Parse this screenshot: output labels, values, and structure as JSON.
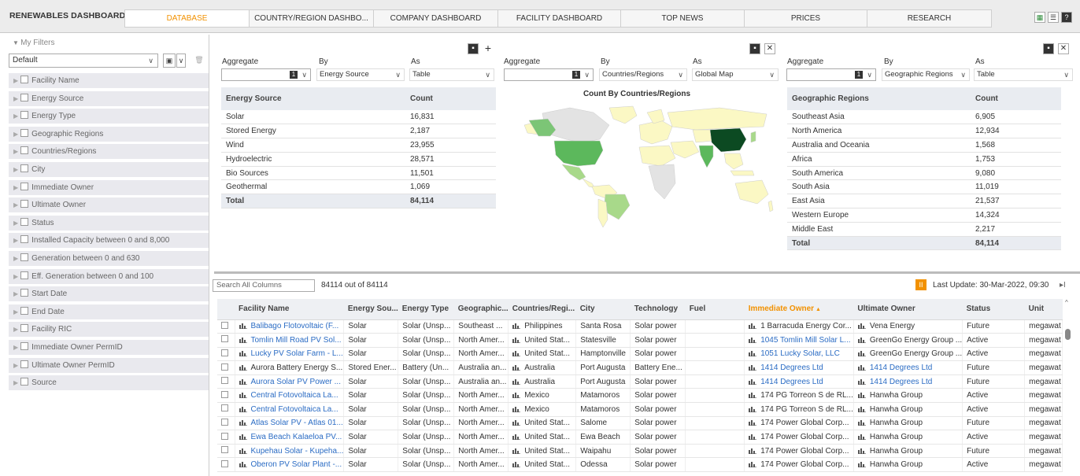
{
  "app": {
    "title": "RENEWABLES DASHBOARD",
    "tabs": [
      {
        "label": "DATABASE",
        "active": true
      },
      {
        "label": "COUNTRY/REGION DASHBO...",
        "active": false
      },
      {
        "label": "COMPANY DASHBOARD",
        "active": false
      },
      {
        "label": "FACILITY DASHBOARD",
        "active": false
      },
      {
        "label": "TOP NEWS",
        "active": false
      },
      {
        "label": "PRICES",
        "active": false
      },
      {
        "label": "RESEARCH",
        "active": false
      }
    ],
    "top_icons": [
      "excel-icon",
      "list-icon",
      "help-icon"
    ],
    "accent_color": "#f29100",
    "link_color": "#2b6cc4"
  },
  "sidebar": {
    "header": "My Filters",
    "selected_filter": "Default",
    "filters": [
      "Facility Name",
      "Energy Source",
      "Energy Type",
      "Geographic Regions",
      "Countries/Regions",
      "City",
      "Immediate Owner",
      "Ultimate Owner",
      "Status",
      "Installed Capacity between 0 and 8,000",
      "Generation between 0 and 630",
      "Eff. Generation between 0 and 100",
      "Start Date",
      "End Date",
      "Facility RIC",
      "Immediate Owner PermID",
      "Ultimate Owner PermID",
      "Source"
    ]
  },
  "widget1": {
    "aggregate_label": "Aggregate",
    "by_label": "By",
    "as_label": "As",
    "aggregate_num": "1",
    "by_value": "Energy Source",
    "as_value": "Table",
    "columns": [
      "Energy Source",
      "Count"
    ],
    "rows": [
      [
        "Solar",
        "16,831"
      ],
      [
        "Stored Energy",
        "2,187"
      ],
      [
        "Wind",
        "23,955"
      ],
      [
        "Hydroelectric",
        "28,571"
      ],
      [
        "Bio Sources",
        "11,501"
      ],
      [
        "Geothermal",
        "1,069"
      ]
    ],
    "total": [
      "Total",
      "84,114"
    ]
  },
  "widget2": {
    "aggregate_label": "Aggregate",
    "by_label": "By",
    "as_label": "As",
    "aggregate_num": "1",
    "by_value": "Countries/Regions",
    "as_value": "Global Map",
    "map_title": "Count By Countries/Regions",
    "map_colors": {
      "base": "#fbf8c4",
      "light_green": "#a8d98a",
      "mid_green": "#5cb85c",
      "dark_green": "#0c4a22",
      "none": "#e3e3e3"
    }
  },
  "widget3": {
    "aggregate_label": "Aggregate",
    "by_label": "By",
    "as_label": "As",
    "aggregate_num": "1",
    "by_value": "Geographic Regions",
    "as_value": "Table",
    "columns": [
      "Geographic Regions",
      "Count"
    ],
    "rows": [
      [
        "Southeast Asia",
        "6,905"
      ],
      [
        "North America",
        "12,934"
      ],
      [
        "Australia and Oceania",
        "1,568"
      ],
      [
        "Africa",
        "1,753"
      ],
      [
        "South America",
        "9,080"
      ],
      [
        "South Asia",
        "11,019"
      ],
      [
        "East Asia",
        "21,537"
      ],
      [
        "Western Europe",
        "14,324"
      ],
      [
        "Middle East",
        "2,217"
      ]
    ],
    "total": [
      "Total",
      "84,114"
    ]
  },
  "grid": {
    "search_placeholder": "Search All Columns",
    "count_text": "84114 out of 84114",
    "last_update": "Last Update: 30-Mar-2022, 09:30",
    "columns": [
      "Facility Name",
      "Energy Sou...",
      "Energy Type",
      "Geographic...",
      "Countries/Regi...",
      "City",
      "Technology",
      "Fuel",
      "Immediate Owner",
      "Ultimate Owner",
      "Status",
      "Unit"
    ],
    "sorted_column": "Immediate Owner",
    "rows": [
      [
        "Balibago Flotovoltaic (F...",
        "Solar",
        "Solar (Unsp...",
        "Southeast ...",
        "Philippines",
        "Santa Rosa",
        "Solar power",
        "",
        "1 Barracuda Energy Cor...",
        "Vena Energy",
        "Future",
        "megawat"
      ],
      [
        "Tomlin Mill Road PV Sol...",
        "Solar",
        "Solar (Unsp...",
        "North Amer...",
        "United Stat...",
        "Statesville",
        "Solar power",
        "",
        "1045 Tomlin Mill Solar L...",
        "GreenGo Energy Group ...",
        "Active",
        "megawat"
      ],
      [
        "Lucky PV Solar Farm - L...",
        "Solar",
        "Solar (Unsp...",
        "North Amer...",
        "United Stat...",
        "Hamptonville",
        "Solar power",
        "",
        "1051 Lucky Solar, LLC",
        "GreenGo Energy Group ...",
        "Active",
        "megawat"
      ],
      [
        "Aurora Battery Energy S...",
        "Stored Ener...",
        "Battery (Un...",
        "Australia an...",
        "Australia",
        "Port Augusta",
        "Battery Ene...",
        "",
        "1414 Degrees Ltd",
        "1414 Degrees Ltd",
        "Future",
        "megawat"
      ],
      [
        "Aurora Solar PV Power ...",
        "Solar",
        "Solar (Unsp...",
        "Australia an...",
        "Australia",
        "Port Augusta",
        "Solar power",
        "",
        "1414 Degrees Ltd",
        "1414 Degrees Ltd",
        "Future",
        "megawat"
      ],
      [
        "Central Fotovoltaica La...",
        "Solar",
        "Solar (Unsp...",
        "North Amer...",
        "Mexico",
        "Matamoros",
        "Solar power",
        "",
        "174 PG Torreon S de RL...",
        "Hanwha Group",
        "Active",
        "megawat"
      ],
      [
        "Central Fotovoltaica La...",
        "Solar",
        "Solar (Unsp...",
        "North Amer...",
        "Mexico",
        "Matamoros",
        "Solar power",
        "",
        "174 PG Torreon S de RL...",
        "Hanwha Group",
        "Active",
        "megawat"
      ],
      [
        "Atlas Solar PV - Atlas 01...",
        "Solar",
        "Solar (Unsp...",
        "North Amer...",
        "United Stat...",
        "Salome",
        "Solar power",
        "",
        "174 Power Global Corp...",
        "Hanwha Group",
        "Future",
        "megawat"
      ],
      [
        "Ewa Beach Kalaeloa PV...",
        "Solar",
        "Solar (Unsp...",
        "North Amer...",
        "United Stat...",
        "Ewa Beach",
        "Solar power",
        "",
        "174 Power Global Corp...",
        "Hanwha Group",
        "Active",
        "megawat"
      ],
      [
        "Kupehau Solar - Kupeha...",
        "Solar",
        "Solar (Unsp...",
        "North Amer...",
        "United Stat...",
        "Waipahu",
        "Solar power",
        "",
        "174 Power Global Corp...",
        "Hanwha Group",
        "Future",
        "megawat"
      ],
      [
        "Oberon PV Solar Plant -...",
        "Solar",
        "Solar (Unsp...",
        "North Amer...",
        "United Stat...",
        "Odessa",
        "Solar power",
        "",
        "174 Power Global Corp...",
        "Hanwha Group",
        "Active",
        "megawat"
      ]
    ],
    "link_rows_facility": [
      true,
      true,
      true,
      false,
      true,
      true,
      true,
      true,
      true,
      true,
      true
    ],
    "link_rows_imm_owner": [
      false,
      true,
      true,
      true,
      true,
      false,
      false,
      false,
      false,
      false,
      false
    ],
    "link_rows_ult_owner": [
      false,
      false,
      false,
      true,
      true,
      false,
      false,
      false,
      false,
      false,
      false
    ]
  }
}
